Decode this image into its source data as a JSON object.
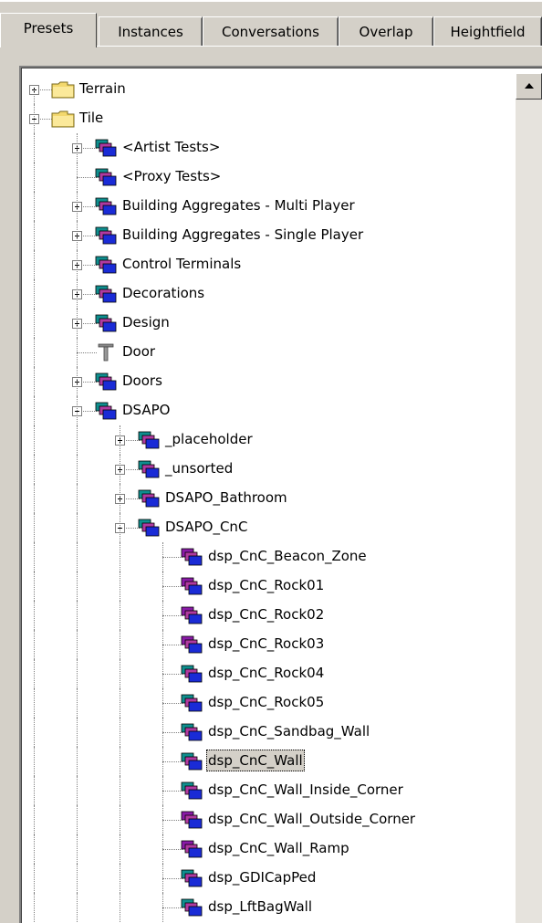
{
  "tabs": [
    {
      "label": "Presets",
      "active": true
    },
    {
      "label": "Instances",
      "active": false
    },
    {
      "label": "Conversations",
      "active": false
    },
    {
      "label": "Overlap",
      "active": false
    },
    {
      "label": "Heightfield",
      "active": false
    }
  ],
  "tree": [
    {
      "label": "Terrain",
      "icon": "folder-icon",
      "toggle": "plus"
    },
    {
      "label": "Tile",
      "icon": "folder-icon",
      "toggle": "minus"
    },
    {
      "label": "<Artist Tests>",
      "icon": "preset-group-icon",
      "toggle": "plus"
    },
    {
      "label": "<Proxy Tests>",
      "icon": "preset-group-icon",
      "toggle": "none"
    },
    {
      "label": "Building Aggregates - Multi Player",
      "icon": "preset-group-icon",
      "toggle": "plus"
    },
    {
      "label": "Building Aggregates - Single Player",
      "icon": "preset-group-icon",
      "toggle": "plus"
    },
    {
      "label": "Control Terminals",
      "icon": "preset-group-icon",
      "toggle": "plus"
    },
    {
      "label": "Decorations",
      "icon": "preset-group-icon",
      "toggle": "plus"
    },
    {
      "label": "Design",
      "icon": "preset-group-icon",
      "toggle": "plus"
    },
    {
      "label": "Door",
      "icon": "door-icon",
      "toggle": "none"
    },
    {
      "label": "Doors",
      "icon": "preset-group-icon",
      "toggle": "plus"
    },
    {
      "label": "DSAPO",
      "icon": "preset-group-icon",
      "toggle": "minus"
    },
    {
      "label": "_placeholder",
      "icon": "preset-group-icon",
      "toggle": "plus"
    },
    {
      "label": "_unsorted",
      "icon": "preset-group-icon",
      "toggle": "plus"
    },
    {
      "label": "DSAPO_Bathroom",
      "icon": "preset-group-icon",
      "toggle": "plus"
    },
    {
      "label": "DSAPO_CnC",
      "icon": "preset-group-icon",
      "toggle": "minus"
    },
    {
      "label": "dsp_CnC_Beacon_Zone",
      "icon": "preset-purple-icon",
      "toggle": "none"
    },
    {
      "label": "dsp_CnC_Rock01",
      "icon": "preset-purple-icon",
      "toggle": "none"
    },
    {
      "label": "dsp_CnC_Rock02",
      "icon": "preset-purple-icon",
      "toggle": "none"
    },
    {
      "label": "dsp_CnC_Rock03",
      "icon": "preset-purple-icon",
      "toggle": "none"
    },
    {
      "label": "dsp_CnC_Rock04",
      "icon": "preset-group-icon",
      "toggle": "none"
    },
    {
      "label": "dsp_CnC_Rock05",
      "icon": "preset-group-icon",
      "toggle": "none"
    },
    {
      "label": "dsp_CnC_Sandbag_Wall",
      "icon": "preset-group-icon",
      "toggle": "none"
    },
    {
      "label": "dsp_CnC_Wall",
      "icon": "preset-group-icon",
      "toggle": "none",
      "selected": true
    },
    {
      "label": "dsp_CnC_Wall_Inside_Corner",
      "icon": "preset-group-icon",
      "toggle": "none"
    },
    {
      "label": "dsp_CnC_Wall_Outside_Corner",
      "icon": "preset-purple-icon",
      "toggle": "none"
    },
    {
      "label": "dsp_CnC_Wall_Ramp",
      "icon": "preset-purple-icon",
      "toggle": "none"
    },
    {
      "label": "dsp_GDICapPed",
      "icon": "preset-group-icon",
      "toggle": "none"
    },
    {
      "label": "dsp_LftBagWall",
      "icon": "preset-group-icon",
      "toggle": "none"
    }
  ],
  "colors": {
    "window_bg": "#d4d0c8",
    "folder": "#f3d86d",
    "blue": "#1a2bd6",
    "teal": "#0f8f8f",
    "purple": "#8a1aa8"
  }
}
